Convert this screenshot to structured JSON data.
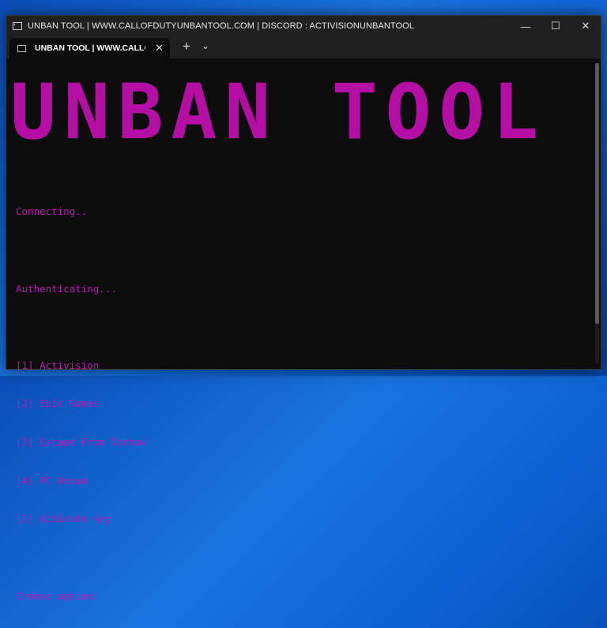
{
  "window": {
    "title": "UNBAN TOOL | WWW.CALLOFDUTYUNBANTOOL.COM | DISCORD : ACTIVISIONUNBANTOOL",
    "minimize_glyph": "—",
    "maximize_glyph": "☐",
    "close_glyph": "✕"
  },
  "tabs": [
    {
      "label": "UNBAN TOOL | WWW.CALLOF",
      "close_glyph": "✕"
    }
  ],
  "tabbar": {
    "new_tab_glyph": "+",
    "dropdown_glyph": "⌄"
  },
  "console": {
    "banner": "UNBAN TOOL",
    "lines": [
      "Connecting..",
      "",
      "Authenticating...",
      "",
      "[1] Activision",
      "[2] Epic Games",
      "[3] Escape From Tarkov",
      "[4] PC Unban",
      "[5] Activate Key",
      "",
      "Choose option:"
    ],
    "text_color": "#bf17b5"
  }
}
